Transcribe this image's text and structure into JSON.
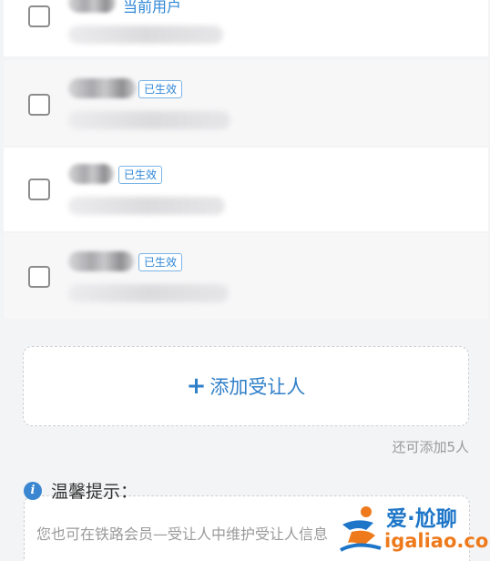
{
  "list": {
    "current_user_label": "当前用户",
    "badges": [
      "已生效",
      "已生效",
      "已生效"
    ]
  },
  "add_button": {
    "plus": "+",
    "label": "添加受让人"
  },
  "remaining_text": "还可添加5人",
  "tips": {
    "icon_glyph": "i",
    "title": "温馨提示：",
    "text": "您也可在铁路会员—受让人中维护受让人信息"
  },
  "watermark": {
    "line1": "爱·尬聊",
    "line2": "igaliao.com"
  },
  "colors": {
    "accent": "#2f7fc9",
    "badge_border": "#7bb3e6",
    "muted": "#9a9a9a"
  }
}
